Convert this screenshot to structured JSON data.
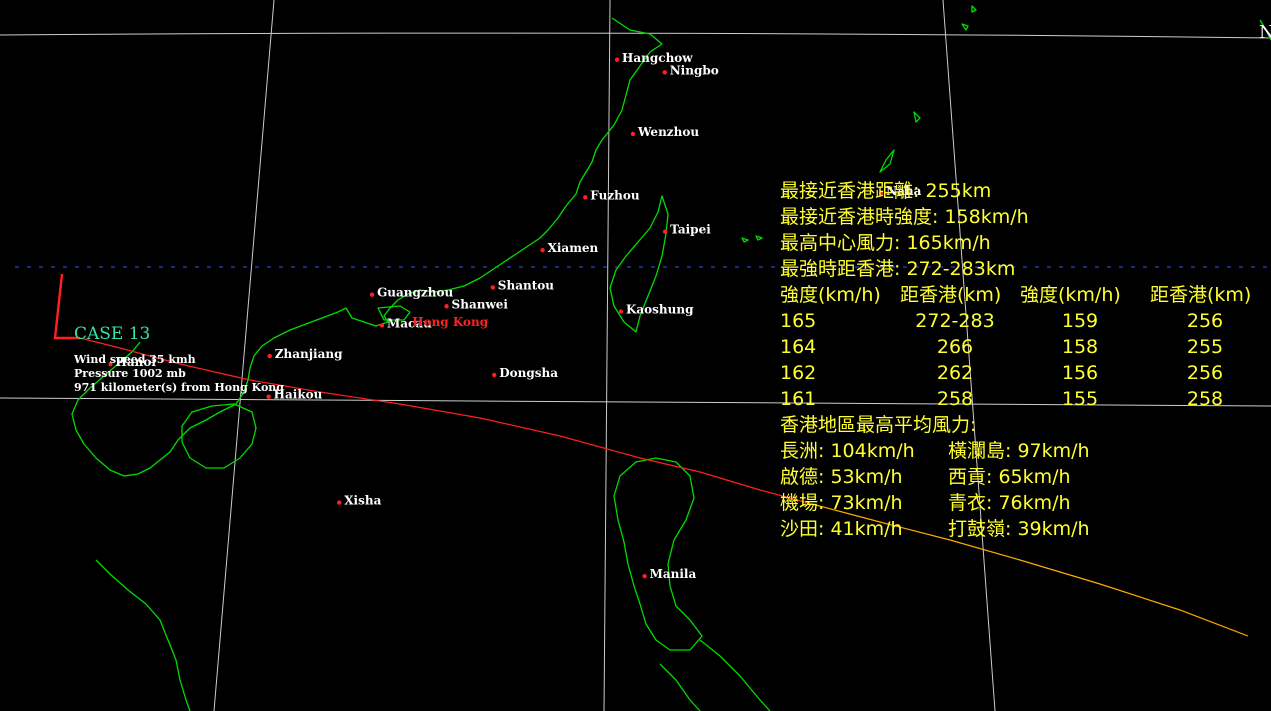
{
  "map": {
    "cities": [
      {
        "name": "Hangchow",
        "lon": 120.2,
        "lat": 30.25
      },
      {
        "name": "Ningbo",
        "lon": 121.55,
        "lat": 29.87
      },
      {
        "name": "Wenzhou",
        "lon": 120.65,
        "lat": 28.0
      },
      {
        "name": "Fuzhou",
        "lon": 119.3,
        "lat": 26.08
      },
      {
        "name": "Naha",
        "lon": 127.68,
        "lat": 26.21
      },
      {
        "name": "Taipei",
        "lon": 121.56,
        "lat": 25.04
      },
      {
        "name": "Xiamen",
        "lon": 118.09,
        "lat": 24.48
      },
      {
        "name": "Shantou",
        "lon": 116.68,
        "lat": 23.35
      },
      {
        "name": "Guangzhou",
        "lon": 113.26,
        "lat": 23.13
      },
      {
        "name": "Shanwei",
        "lon": 115.37,
        "lat": 22.78
      },
      {
        "name": "Macau",
        "lon": 113.54,
        "lat": 22.2
      },
      {
        "name": "Kaoshung",
        "lon": 120.31,
        "lat": 22.62
      },
      {
        "name": "Hanoi",
        "lon": 105.85,
        "lat": 21.03
      },
      {
        "name": "Zhanjiang",
        "lon": 110.36,
        "lat": 21.27
      },
      {
        "name": "Dongsha",
        "lon": 116.72,
        "lat": 20.7
      },
      {
        "name": "Haikou",
        "lon": 110.33,
        "lat": 20.04
      },
      {
        "name": "Xisha",
        "lon": 112.33,
        "lat": 16.83
      },
      {
        "name": "Manila",
        "lon": 120.98,
        "lat": 14.6
      }
    ],
    "hong_kong": {
      "name": "Hong Kong",
      "lon": 114.17,
      "lat": 22.3
    },
    "track_colors": {
      "recent": "#ff2020",
      "older": "#ffaa00"
    },
    "coast_color": "#00dd00",
    "grid_color": "#cccccc",
    "line_800km_color": "#3355ff"
  },
  "case": {
    "title": "CASE 13",
    "wind": "Wind speed 35 kmh",
    "pressure": "Pressure 1002 mb",
    "distance": "971 kilometer(s) from Hong Kong"
  },
  "corner_label": "N",
  "info": {
    "closest_distance": "最接近香港距離: 255km",
    "closest_intensity": "最接近香港時強度: 158km/h",
    "max_wind": "最高中心風力: 165km/h",
    "max_distance": "最強時距香港: 272-283km",
    "headers": [
      "強度(km/h)",
      "距香港(km)",
      "強度(km/h)",
      "距香港(km)"
    ],
    "rows": [
      [
        "165",
        "272-283",
        "159",
        "256"
      ],
      [
        "164",
        "266",
        "158",
        "255"
      ],
      [
        "162",
        "262",
        "156",
        "256"
      ],
      [
        "161",
        "258",
        "155",
        "258"
      ]
    ],
    "hk_winds_title": "香港地區最高平均風力:",
    "hk_winds": [
      [
        "長洲: 104km/h",
        "橫瀾島: 97km/h"
      ],
      [
        "啟德: 53km/h",
        "西貢: 65km/h"
      ],
      [
        "機場: 73km/h",
        "青衣: 76km/h"
      ],
      [
        "沙田: 41km/h",
        "打鼓嶺: 39km/h"
      ]
    ]
  }
}
